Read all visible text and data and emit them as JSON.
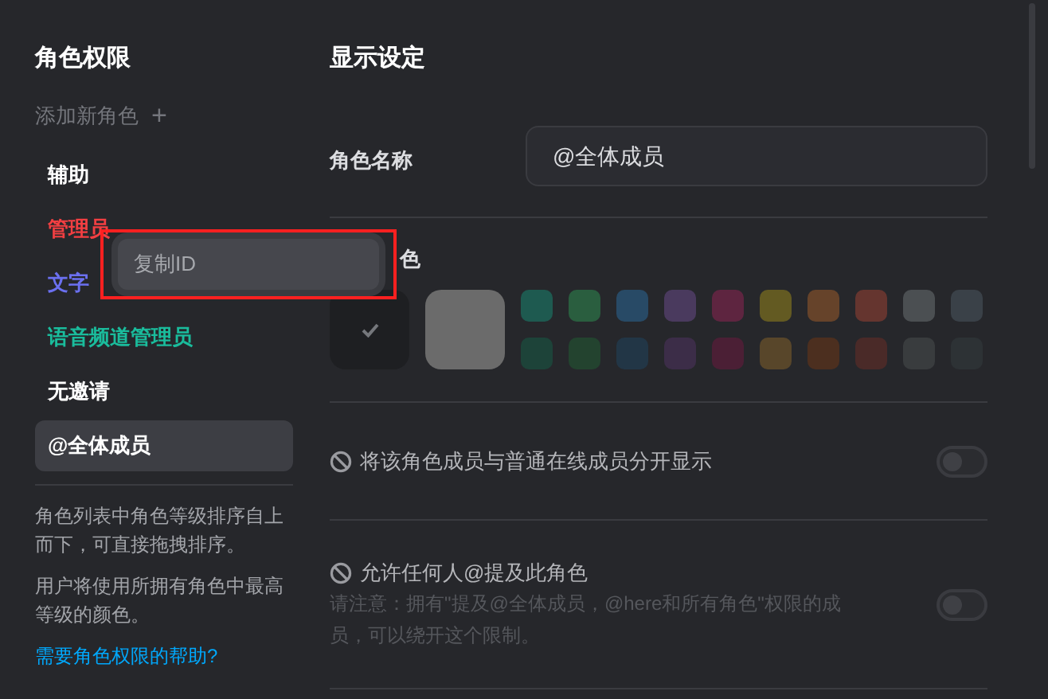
{
  "sidebar": {
    "title": "角色权限",
    "add_role": {
      "label": "添加新角色",
      "icon": "+"
    },
    "roles": [
      {
        "name": "辅助",
        "color": "#ffffff",
        "selected": false
      },
      {
        "name": "管理员",
        "color": "#f23f42",
        "selected": false
      },
      {
        "name": "文字",
        "color": "#6b70f0",
        "selected": false
      },
      {
        "name": "语音频道管理员",
        "color": "#1abc9c",
        "selected": false
      },
      {
        "name": "无邀请",
        "color": "#ffffff",
        "selected": false
      },
      {
        "name": "@全体成员",
        "color": "#ffffff",
        "selected": true
      }
    ],
    "notes": [
      "角色列表中角色等级排序自上而下，可直接拖拽排序。",
      "用户将使用所拥有角色中最高等级的颜色。"
    ],
    "help_link": "需要角色权限的帮助?"
  },
  "context_menu": {
    "items": [
      {
        "label": "复制ID"
      }
    ]
  },
  "main": {
    "title": "显示设定",
    "role_name": {
      "label": "角色名称",
      "value": "@全体成员"
    },
    "role_color": {
      "label": "色",
      "default_selected": true,
      "custom_swatch": {
        "color": "#6b6b6b"
      },
      "swatches": [
        {
          "color": "#1e5a50",
          "selected": false
        },
        {
          "color": "#2a5e3f",
          "selected": false
        },
        {
          "color": "#284a66",
          "selected": false
        },
        {
          "color": "#4a3a5e",
          "selected": false
        },
        {
          "color": "#5e2540",
          "selected": false
        },
        {
          "color": "#635a22",
          "selected": false
        },
        {
          "color": "#66432a",
          "selected": false
        },
        {
          "color": "#65352f",
          "selected": false
        },
        {
          "color": "#4b4f52",
          "selected": false
        },
        {
          "color": "#3a4148",
          "selected": false
        },
        {
          "color": "#1d4339",
          "selected": false
        },
        {
          "color": "#23432f",
          "selected": false
        },
        {
          "color": "#223646",
          "selected": false
        },
        {
          "color": "#3c2d48",
          "selected": false
        },
        {
          "color": "#4b1f35",
          "selected": false
        },
        {
          "color": "#58462a",
          "selected": false
        },
        {
          "color": "#4c2f1f",
          "selected": false
        },
        {
          "color": "#4a2a28",
          "selected": false
        },
        {
          "color": "#393c3e",
          "selected": false
        },
        {
          "color": "#2d3235",
          "selected": false
        }
      ]
    },
    "settings": [
      {
        "label": "将该角色成员与普通在线成员分开显示",
        "on": false
      },
      {
        "label": "允许任何人@提及此角色",
        "note": "请注意：拥有\"提及@全体成员，@here和所有角色\"权限的成员，可以绕开这个限制。",
        "on": false
      }
    ]
  }
}
